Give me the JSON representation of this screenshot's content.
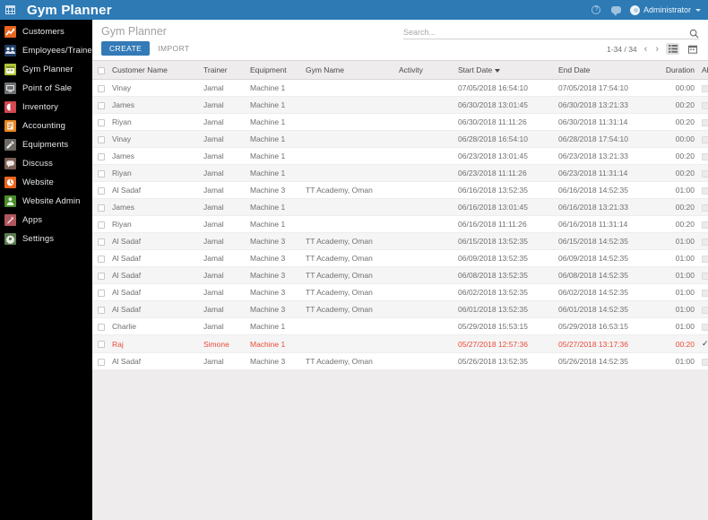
{
  "topbar": {
    "apps_icon": "grid-apps-icon",
    "title": "Gym Planner",
    "help_icon": "question-circle-icon",
    "chat_icon": "chat-bubble-icon",
    "user_name": "Administrator",
    "brand_color": "#2d7ab5"
  },
  "sidebar": {
    "items": [
      {
        "label": "Customers",
        "icon": "chart-line-icon",
        "color": "#e8651f"
      },
      {
        "label": "Employees/Trainer",
        "icon": "people-group-icon",
        "color": "#1f3c63"
      },
      {
        "label": "Gym Planner",
        "icon": "calendar-icon",
        "color": "#b2c43a"
      },
      {
        "label": "Point of Sale",
        "icon": "monitor-icon",
        "color": "#6e7275"
      },
      {
        "label": "Inventory",
        "icon": "box-split-icon",
        "color": "#d0464f"
      },
      {
        "label": "Accounting",
        "icon": "book-icon",
        "color": "#e8861f"
      },
      {
        "label": "Equipments",
        "icon": "hammer-icon",
        "color": "#6d6a66"
      },
      {
        "label": "Discuss",
        "icon": "speech-bubble-icon",
        "color": "#7a5f56"
      },
      {
        "label": "Website",
        "icon": "globe-clock-icon",
        "color": "#e8651f"
      },
      {
        "label": "Website Admin",
        "icon": "person-gear-icon",
        "color": "#4a8c2a"
      },
      {
        "label": "Apps",
        "icon": "puzzle-icon",
        "color": "#b2565e"
      },
      {
        "label": "Settings",
        "icon": "gear-icon",
        "color": "#5a7a50"
      }
    ]
  },
  "control_panel": {
    "breadcrumb": "Gym Planner",
    "create_label": "CREATE",
    "import_label": "IMPORT"
  },
  "search": {
    "placeholder": "Search...",
    "value": "",
    "icon": "search-icon"
  },
  "pager": {
    "count_label": "1-34 / 34",
    "prev_icon": "chevron-left-icon",
    "next_icon": "chevron-right-icon",
    "list_view_icon": "list-view-icon",
    "calendar_view_icon": "calendar-view-icon",
    "active_view": "list"
  },
  "table": {
    "columns": [
      "Customer Name",
      "Trainer",
      "Equipment",
      "Gym Name",
      "Activity",
      "Start Date",
      "End Date",
      "Duration",
      "Absent"
    ],
    "sorted_column": "Start Date",
    "sort_direction": "desc",
    "rows": [
      {
        "customer": "Vinay",
        "trainer": "Jamal",
        "equipment": "Machine 1",
        "gym": "",
        "activity": "",
        "start": "07/05/2018 16:54:10",
        "end": "07/05/2018 17:54:10",
        "duration": "00:00",
        "absent": false,
        "highlight": false
      },
      {
        "customer": "James",
        "trainer": "Jamal",
        "equipment": "Machine 1",
        "gym": "",
        "activity": "",
        "start": "06/30/2018 13:01:45",
        "end": "06/30/2018 13:21:33",
        "duration": "00:20",
        "absent": false,
        "highlight": false
      },
      {
        "customer": "Riyan",
        "trainer": "Jamal",
        "equipment": "Machine 1",
        "gym": "",
        "activity": "",
        "start": "06/30/2018 11:11:26",
        "end": "06/30/2018 11:31:14",
        "duration": "00:20",
        "absent": false,
        "highlight": false
      },
      {
        "customer": "Vinay",
        "trainer": "Jamal",
        "equipment": "Machine 1",
        "gym": "",
        "activity": "",
        "start": "06/28/2018 16:54:10",
        "end": "06/28/2018 17:54:10",
        "duration": "00:00",
        "absent": false,
        "highlight": false
      },
      {
        "customer": "James",
        "trainer": "Jamal",
        "equipment": "Machine 1",
        "gym": "",
        "activity": "",
        "start": "06/23/2018 13:01:45",
        "end": "06/23/2018 13:21:33",
        "duration": "00:20",
        "absent": false,
        "highlight": false
      },
      {
        "customer": "Riyan",
        "trainer": "Jamal",
        "equipment": "Machine 1",
        "gym": "",
        "activity": "",
        "start": "06/23/2018 11:11:26",
        "end": "06/23/2018 11:31:14",
        "duration": "00:20",
        "absent": false,
        "highlight": false
      },
      {
        "customer": "Al Sadaf",
        "trainer": "Jamal",
        "equipment": "Machine 3",
        "gym": "TT Academy, Oman",
        "activity": "",
        "start": "06/16/2018 13:52:35",
        "end": "06/16/2018 14:52:35",
        "duration": "01:00",
        "absent": false,
        "highlight": false
      },
      {
        "customer": "James",
        "trainer": "Jamal",
        "equipment": "Machine 1",
        "gym": "",
        "activity": "",
        "start": "06/16/2018 13:01:45",
        "end": "06/16/2018 13:21:33",
        "duration": "00:20",
        "absent": false,
        "highlight": false
      },
      {
        "customer": "Riyan",
        "trainer": "Jamal",
        "equipment": "Machine 1",
        "gym": "",
        "activity": "",
        "start": "06/16/2018 11:11:26",
        "end": "06/16/2018 11:31:14",
        "duration": "00:20",
        "absent": false,
        "highlight": false
      },
      {
        "customer": "Al Sadaf",
        "trainer": "Jamal",
        "equipment": "Machine 3",
        "gym": "TT Academy, Oman",
        "activity": "",
        "start": "06/15/2018 13:52:35",
        "end": "06/15/2018 14:52:35",
        "duration": "01:00",
        "absent": false,
        "highlight": false
      },
      {
        "customer": "Al Sadaf",
        "trainer": "Jamal",
        "equipment": "Machine 3",
        "gym": "TT Academy, Oman",
        "activity": "",
        "start": "06/09/2018 13:52:35",
        "end": "06/09/2018 14:52:35",
        "duration": "01:00",
        "absent": false,
        "highlight": false
      },
      {
        "customer": "Al Sadaf",
        "trainer": "Jamal",
        "equipment": "Machine 3",
        "gym": "TT Academy, Oman",
        "activity": "",
        "start": "06/08/2018 13:52:35",
        "end": "06/08/2018 14:52:35",
        "duration": "01:00",
        "absent": false,
        "highlight": false
      },
      {
        "customer": "Al Sadaf",
        "trainer": "Jamal",
        "equipment": "Machine 3",
        "gym": "TT Academy, Oman",
        "activity": "",
        "start": "06/02/2018 13:52:35",
        "end": "06/02/2018 14:52:35",
        "duration": "01:00",
        "absent": false,
        "highlight": false
      },
      {
        "customer": "Al Sadaf",
        "trainer": "Jamal",
        "equipment": "Machine 3",
        "gym": "TT Academy, Oman",
        "activity": "",
        "start": "06/01/2018 13:52:35",
        "end": "06/01/2018 14:52:35",
        "duration": "01:00",
        "absent": false,
        "highlight": false
      },
      {
        "customer": "Charlie",
        "trainer": "Jamal",
        "equipment": "Machine 1",
        "gym": "",
        "activity": "",
        "start": "05/29/2018 15:53:15",
        "end": "05/29/2018 16:53:15",
        "duration": "01:00",
        "absent": false,
        "highlight": false
      },
      {
        "customer": "Raj",
        "trainer": "Simone",
        "equipment": "Machine 1",
        "gym": "",
        "activity": "",
        "start": "05/27/2018 12:57:36",
        "end": "05/27/2018 13:17:36",
        "duration": "00:20",
        "absent": true,
        "highlight": true
      },
      {
        "customer": "Al Sadaf",
        "trainer": "Jamal",
        "equipment": "Machine 3",
        "gym": "TT Academy, Oman",
        "activity": "",
        "start": "05/26/2018 13:52:35",
        "end": "05/26/2018 14:52:35",
        "duration": "01:00",
        "absent": false,
        "highlight": false
      }
    ]
  },
  "colors": {
    "accent": "#337ab7",
    "brand": "#2d7ab5",
    "alert_row": "#e74c3c",
    "page_bg": "#eeeced"
  }
}
